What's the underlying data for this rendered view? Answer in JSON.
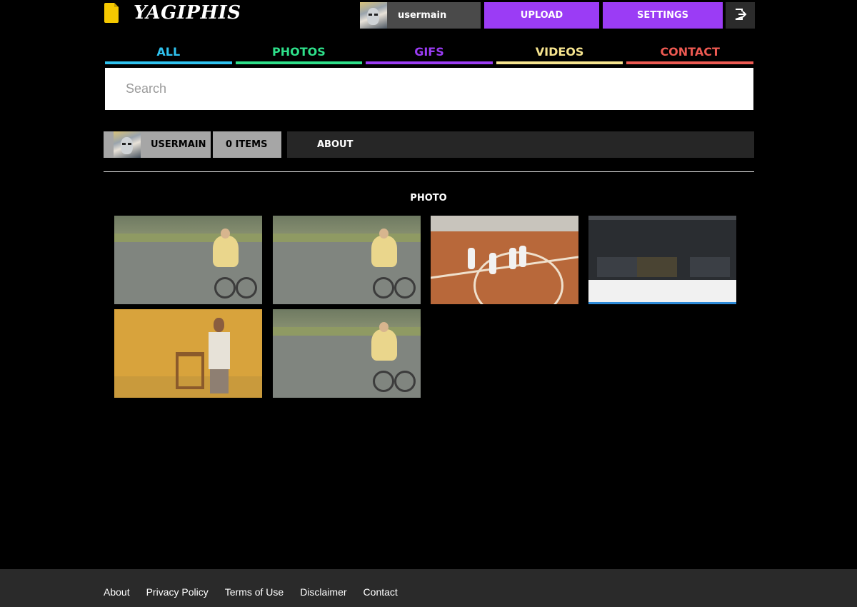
{
  "header": {
    "logo_text": "YAGIPHIS",
    "username": "usermain",
    "upload_label": "UPLOAD",
    "settings_label": "SETTINGS"
  },
  "tabs": [
    {
      "label": "ALL",
      "color": "#2fc3f0"
    },
    {
      "label": "PHOTOS",
      "color": "#2ee08a"
    },
    {
      "label": "GIFS",
      "color": "#9b3cf5"
    },
    {
      "label": "VIDEOS",
      "color": "#f7e58f"
    },
    {
      "label": "CONTACT",
      "color": "#ee5a52"
    }
  ],
  "search": {
    "placeholder": "Search"
  },
  "profile_bar": {
    "username": "USERMAIN",
    "items_count": "0 ITEMS",
    "about_label": "ABOUT"
  },
  "section": {
    "title": "PHOTO"
  },
  "thumbnails": [
    {
      "kind": "bike"
    },
    {
      "kind": "bike"
    },
    {
      "kind": "basketball-court"
    },
    {
      "kind": "screenshot"
    },
    {
      "kind": "man-with-chair"
    },
    {
      "kind": "bike"
    }
  ],
  "footer": {
    "links": [
      "About",
      "Privacy Policy",
      "Terms of Use",
      "Disclaimer",
      "Contact"
    ]
  },
  "icons": {
    "logo": "file-icon",
    "logout": "logout-icon"
  },
  "colors": {
    "accent": "#9b3cf5",
    "logo": "#f5c800"
  }
}
